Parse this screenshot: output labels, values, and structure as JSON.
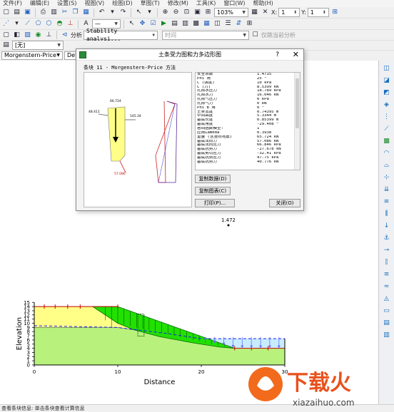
{
  "menu": [
    "文件(F)",
    "编辑(E)",
    "设置(S)",
    "视图(V)",
    "绘图(D)",
    "草图(T)",
    "修改(M)",
    "工具(K)",
    "窗口(W)",
    "帮助(H)"
  ],
  "toolbar": {
    "zoom": "103%",
    "x_label": "X:",
    "x_value": "1",
    "y_label": "Y:",
    "y_value": "1",
    "analysis_label": "分析",
    "analysis_combo": "Stability analysi...",
    "time_label": "时间",
    "only_current_label": "仅跳当前分析",
    "none_combo": "[无]"
  },
  "tabs": [
    "Morgenstern-Price",
    "Def"
  ],
  "dialog": {
    "title": "土条受力图和力多边形图",
    "help": "?",
    "close": "✕",
    "subtitle": "条块 11 - Morgenstern-Price 方法",
    "buttons": {
      "copy_data": "复制数据(D)",
      "copy_chart": "复制图表(C)",
      "print": "打印(P)...",
      "close": "关闭(O)"
    },
    "properties": [
      {
        "k": "安全系数",
        "v": "1.4715"
      },
      {
        "k": "Phi 角",
        "v": "25 °"
      },
      {
        "k": "C (强度)",
        "v": "10 kPa"
      },
      {
        "k": "C (力)",
        "v": "8.5399 kN"
      },
      {
        "k": "孔隙水压力",
        "v": "18.789 kPa"
      },
      {
        "k": "孔隙水力",
        "v": "16.046 kN"
      },
      {
        "k": "孔隙气压力",
        "v": "0 kPa"
      },
      {
        "k": "孔隙气力",
        "v": "0 kN"
      },
      {
        "k": "Phi B 角",
        "v": "0 °"
      },
      {
        "k": "土条宽度",
        "v": "0.74395 m"
      },
      {
        "k": "中间高度",
        "v": "5.3344 m"
      },
      {
        "k": "基底长度",
        "v": "0.85399 m"
      },
      {
        "k": "基底角度",
        "v": "-29.408 °"
      },
      {
        "k": "容间函数模型:",
        "v": "1"
      },
      {
        "k": "应用Lambda",
        "v": "0.3938"
      },
      {
        "k": "重量 (含竖向地震)",
        "v": "65.724 kN"
      },
      {
        "k": "基底法向力",
        "v": "57.086 kN"
      },
      {
        "k": "基底法向应力",
        "v": "66.846 kPa"
      },
      {
        "k": "基底抗剪力",
        "v": "-27.678 kN"
      },
      {
        "k": "基底剪切应力",
        "v": "-32.41 kPa"
      },
      {
        "k": "基底抗剪应力",
        "v": "47.75 kPa"
      },
      {
        "k": "基底抗剪力",
        "v": "40.776 kN"
      }
    ],
    "free_body": {
      "left_force": "48.411",
      "top_force": "66.724",
      "right_force": "145.34",
      "bottom_force": "57.086"
    }
  },
  "chart_data": {
    "type": "diagram",
    "factor_of_safety": "1.472",
    "xlabel": "Distance",
    "ylabel": "Elevation",
    "xlim": [
      0,
      30
    ],
    "ylim": [
      0,
      15
    ],
    "xticks": [
      "0",
      "10",
      "20",
      "30"
    ],
    "yticks": [
      "0",
      "1",
      "2",
      "3",
      "4",
      "5",
      "6",
      "7",
      "8",
      "9",
      "10",
      "11",
      "12",
      "13",
      "14",
      "15"
    ],
    "colors": {
      "lower_soil": "#b8f27c",
      "upper_soil": "#ffff88",
      "sliding_mass": "#22e000",
      "water": "#c8ecff",
      "water_load": "#6e6ef0",
      "surface": "#cc0000"
    }
  },
  "status": "查看条块信息: 单击条块查看计算信息",
  "watermark": {
    "brand": "下载火",
    "url": "xiazaihuo.com"
  }
}
